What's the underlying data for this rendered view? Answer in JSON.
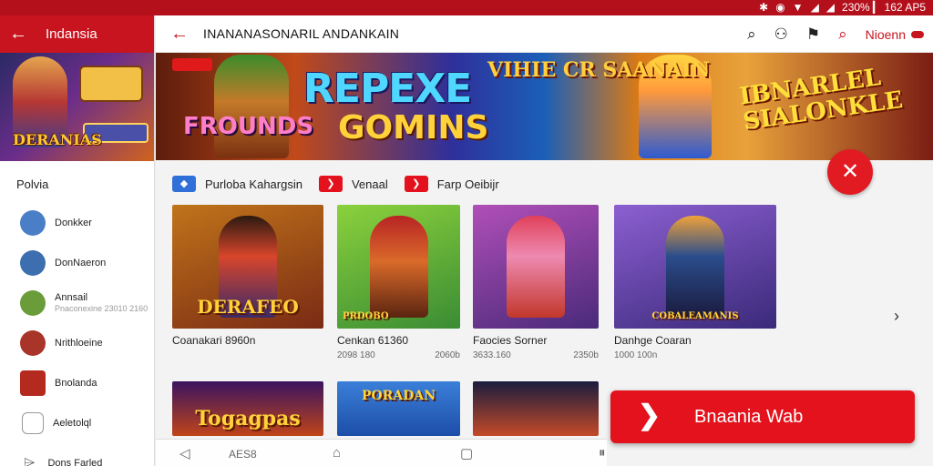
{
  "status_bar": {
    "right_text": "230% ▎ 162 AP5",
    "icons": [
      "bluetooth-icon",
      "circle-icon",
      "wifi-icon",
      "signal-icon",
      "signal-icon-2"
    ]
  },
  "sidebar": {
    "title": "Indansia",
    "banner_label": "DERANIAS",
    "section_label": "Polvia",
    "items": [
      {
        "label": "Donkker",
        "sub": ""
      },
      {
        "label": "DonNaeron",
        "sub": ""
      },
      {
        "label": "Annsail",
        "sub": "Pnaconexine 23010 2160"
      },
      {
        "label": "Nrithloeine",
        "sub": ""
      },
      {
        "label": "Bnolanda",
        "sub": ""
      },
      {
        "label": "Aeletolql",
        "sub": ""
      },
      {
        "label": "Dons Farled",
        "sub": ""
      }
    ]
  },
  "topbar": {
    "title": "INANANASONARIL ANDANKAIN",
    "account_label": "Nioenn"
  },
  "banner": {
    "text_main": "REPEXE",
    "text_left": "FROUNDS",
    "text_mid": "GOMINS",
    "text_sign": "VIHIE CR SAANAIN",
    "text_right": "IBNARLEL SIALONKLE"
  },
  "filters": [
    {
      "label": "Purloba Kahargsin",
      "color": "#2f6fd8"
    },
    {
      "label": "Venaal",
      "color": "#e3121c"
    },
    {
      "label": "Farp Oeibijr",
      "color": "#e3121c"
    }
  ],
  "games_row1": [
    {
      "name": "Coanakari 8960n",
      "meta_left": "",
      "meta_right": "",
      "caption": "DERAFEO",
      "bg": "#7a2a14",
      "fig": "#d8452b"
    },
    {
      "name": "Cenkan 61360",
      "meta_left": "2098 180",
      "meta_right": "2060b",
      "caption": "PRDOBO",
      "bg": "#3a8c34",
      "fig": "#b82424"
    },
    {
      "name": "Faocies Sorner",
      "meta_left": "3633.160",
      "meta_right": "2350b",
      "caption": "",
      "bg": "#7b2f8a",
      "fig": "#e05a8a"
    },
    {
      "name": "Danhge Coaran",
      "meta_left": "1000 100n",
      "meta_right": "",
      "caption": "COBALEAMANIS",
      "bg": "#5a3f9a",
      "fig": "#2b4d8c"
    }
  ],
  "games_row2": [
    {
      "caption": "Togagpas",
      "bg": "#c0441a",
      "fig": "#f2a93a"
    },
    {
      "caption": "PORADAN",
      "bg": "#1c4ea8",
      "fig": "#3b7fd8"
    },
    {
      "caption": "",
      "bg": "#1a1c3e",
      "fig": "#c44a28"
    }
  ],
  "cta": {
    "label": "Bnaania Wab"
  },
  "navbar": {
    "text": "AES8"
  }
}
